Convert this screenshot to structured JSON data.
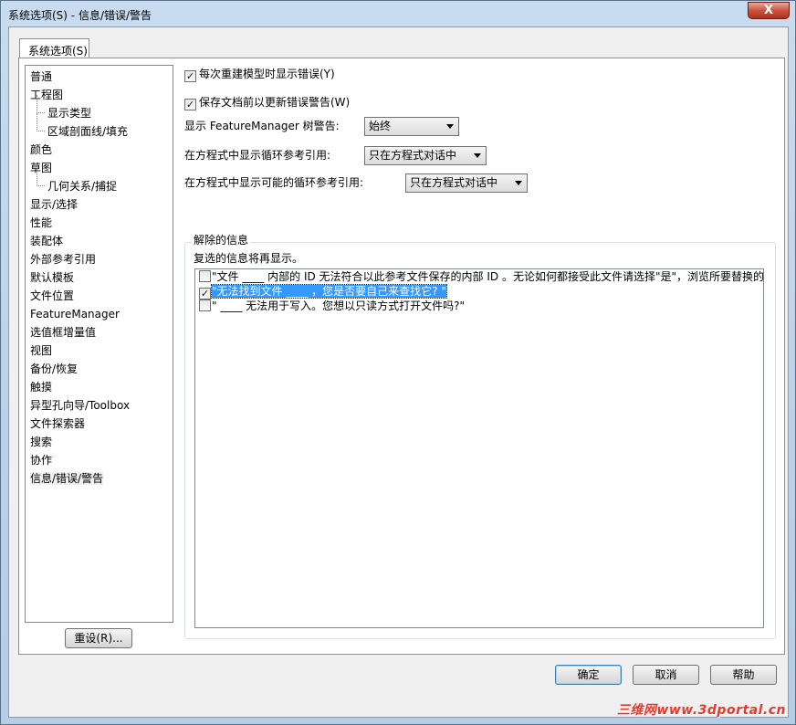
{
  "window": {
    "title": "系统选项(S) - 信息/错误/警告",
    "close_label": "X"
  },
  "tab": {
    "label": "系统选项(S)"
  },
  "tree": {
    "items": [
      {
        "label": "普通",
        "level": 0
      },
      {
        "label": "工程图",
        "level": 0
      },
      {
        "label": "显示类型",
        "level": 1
      },
      {
        "label": "区域剖面线/填充",
        "level": 1
      },
      {
        "label": "颜色",
        "level": 0
      },
      {
        "label": "草图",
        "level": 0
      },
      {
        "label": "几何关系/捕捉",
        "level": 1
      },
      {
        "label": "显示/选择",
        "level": 0
      },
      {
        "label": "性能",
        "level": 0
      },
      {
        "label": "装配体",
        "level": 0
      },
      {
        "label": "外部参考引用",
        "level": 0
      },
      {
        "label": "默认模板",
        "level": 0
      },
      {
        "label": "文件位置",
        "level": 0
      },
      {
        "label": "FeatureManager",
        "level": 0
      },
      {
        "label": "选值框增量值",
        "level": 0
      },
      {
        "label": "视图",
        "level": 0
      },
      {
        "label": "备份/恢复",
        "level": 0
      },
      {
        "label": "触摸",
        "level": 0
      },
      {
        "label": "异型孔向导/Toolbox",
        "level": 0
      },
      {
        "label": "文件探索器",
        "level": 0
      },
      {
        "label": "搜索",
        "level": 0
      },
      {
        "label": "协作",
        "level": 0
      },
      {
        "label": "信息/错误/警告",
        "level": 0,
        "selected": true
      }
    ]
  },
  "reset_button": "重设(R)...",
  "options": {
    "show_errors_rebuild": {
      "label": "每次重建模型时显示错误(Y)",
      "checked": true
    },
    "save_before_update": {
      "label": "保存文档前以更新错误警告(W)",
      "checked": true
    },
    "fm_tree_warning": {
      "label": "显示 FeatureManager 树警告:",
      "value": "始终"
    },
    "circular_ref": {
      "label": "在方程式中显示循环参考引用:",
      "value": "只在方程式对话中"
    },
    "possible_circular_ref": {
      "label": "在方程式中显示可能的循环参考引用:",
      "value": "只在方程式对话中"
    }
  },
  "dismissed": {
    "group_title": "解除的信息",
    "description": "复选的信息将再显示。",
    "messages": [
      {
        "text": "\"文件 ____ 内部的 ID 无法符合以此参考文件保存的内部 ID 。无论如何都接受此文件请选择\"是\"，浏览所要替换的模",
        "checked": false,
        "selected": false
      },
      {
        "text": "\"无法找到文件 ____ ，您是否要自己来查找它? \"",
        "checked": true,
        "selected": true
      },
      {
        "text": "\" ____ 无法用于写入。您想以只读方式打开文件吗?\"",
        "checked": false,
        "selected": false
      }
    ]
  },
  "buttons": {
    "ok": "确定",
    "cancel": "取消",
    "help": "帮助"
  },
  "watermark": "三维网www.3dportal.cn",
  "check_mark": "✓"
}
